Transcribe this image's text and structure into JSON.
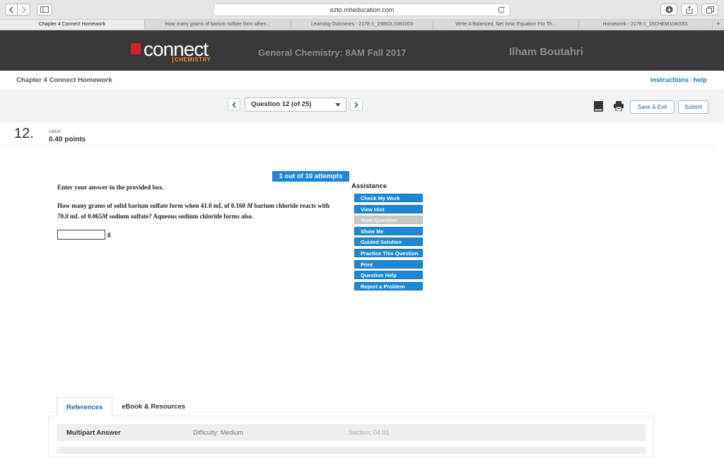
{
  "browser": {
    "url": "ezto.mheducation.com",
    "tabs": [
      {
        "label": "Chapter 4 Connect Homework",
        "active": true
      },
      {
        "label": "How many grams of barium sulfate form when...",
        "active": false
      },
      {
        "label": "Learning Outcomes - 2178-1_15BIOL1081003",
        "active": false
      },
      {
        "label": "Write A Balanced, Net Ionic Equation For Th...",
        "active": false
      },
      {
        "label": "Homework - 2178-1_15CHEM1040001",
        "active": false
      }
    ],
    "new_tab": "+"
  },
  "header": {
    "logo_text": "connect",
    "logo_sub": "CHEMISTRY",
    "course": "General Chemistry: 8AM Fall 2017",
    "user": "Ilham Boutahri"
  },
  "assignment": {
    "title": "Chapter 4 Connect Homework",
    "instructions_link": "instructions",
    "help_link": "help",
    "link_separator": "|"
  },
  "question_nav": {
    "selected": "Question 12 (of 25)",
    "save_exit": "Save & Exit",
    "submit": "Submit"
  },
  "question": {
    "number": "12.",
    "value_label": "value:",
    "points": "0.40 points",
    "attempts": "1 out of 10 attempts",
    "instruction": "Enter your answer in the provided box.",
    "text_part1": "How many grams of solid barium sulfate form when 41.0 mL of 0.160 ",
    "text_M1": "M",
    "text_part2": " barium chloride reacts with 70.0 mL of 0.065",
    "text_M2": "M",
    "text_part3": "  sodium sulfate? Aqueous sodium chloride forms also.",
    "answer_value": "",
    "unit": "g"
  },
  "assistance": {
    "title": "Assistance",
    "buttons": [
      {
        "label": "Check My Work",
        "disabled": false
      },
      {
        "label": "View Hint",
        "disabled": false
      },
      {
        "label": "View Question",
        "disabled": true
      },
      {
        "label": "Show Me",
        "disabled": false
      },
      {
        "label": "Guided Solution",
        "disabled": false
      },
      {
        "label": "Practice This Question",
        "disabled": false
      },
      {
        "label": "Print",
        "disabled": false
      },
      {
        "label": "Question Help",
        "disabled": false
      },
      {
        "label": "Report a Problem",
        "disabled": false
      }
    ]
  },
  "references": {
    "tabs": [
      "References",
      "eBook & Resources"
    ],
    "row_title": "Multipart Answer",
    "difficulty": "Difficulty: Medium",
    "section": "Section: 04.01"
  },
  "colors": {
    "accent": "#1e88d6",
    "header_bg": "#383838",
    "brand_red": "#d4202a",
    "brand_orange": "#f08a2a"
  }
}
